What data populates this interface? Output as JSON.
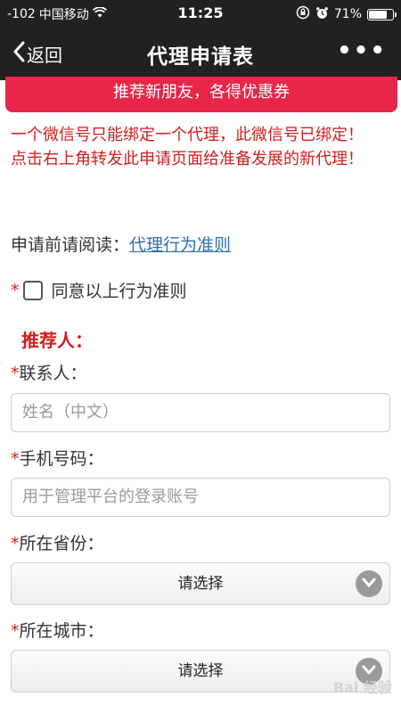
{
  "status_bar": {
    "signal": "-102",
    "carrier": "中国移动",
    "time": "11:25",
    "battery": "71%"
  },
  "nav": {
    "back_label": "返回",
    "title": "代理申请表",
    "more_label": "•••"
  },
  "banner": {
    "text": "推荐新朋友，各得优惠券"
  },
  "notice": {
    "line1": "一个微信号只能绑定一个代理，此微信号已绑定！",
    "line2": "点击右上角转发此申请页面给准备发展的新代理！"
  },
  "read": {
    "prefix": "申请前请阅读：",
    "link": "代理行为准则"
  },
  "agree": {
    "star": "*",
    "label": "同意以上行为准则"
  },
  "section": {
    "title": "推荐人："
  },
  "form": {
    "contact": {
      "label": "联系人：",
      "placeholder": "姓名（中文）"
    },
    "phone": {
      "label": "手机号码：",
      "placeholder": "用于管理平台的登录账号"
    },
    "province": {
      "label": "所在省份：",
      "value": "请选择"
    },
    "city": {
      "label": "所在城市：",
      "value": "请选择"
    }
  },
  "watermark": {
    "text": "Bai 经验"
  }
}
